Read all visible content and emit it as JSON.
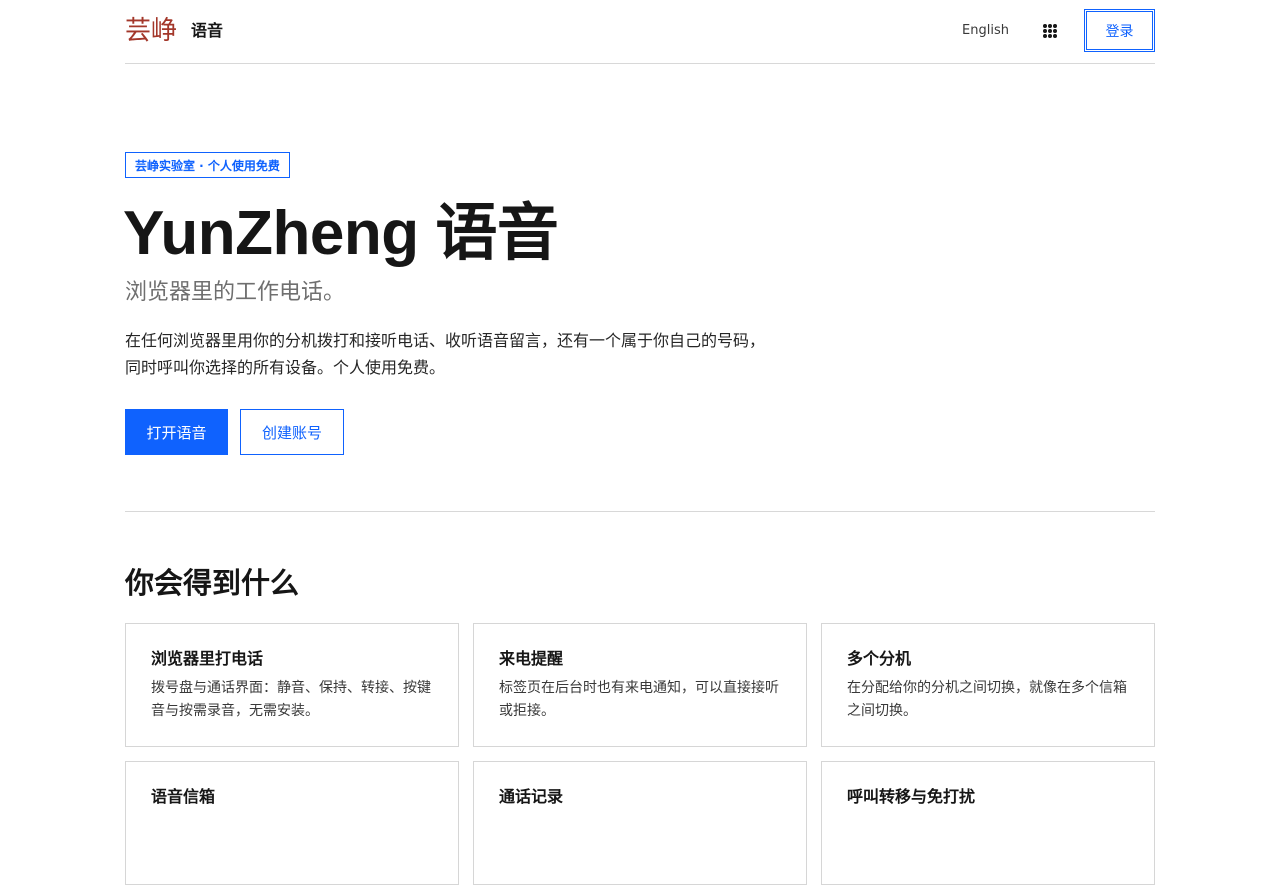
{
  "header": {
    "brand_logo": "芸峥",
    "product_name": "语音",
    "language_link": "English",
    "apps_icon": "grid-dots-icon",
    "login_label": "登录"
  },
  "hero": {
    "tag": "芸峥实验室 · 个人使用免费",
    "title": "YunZheng 语音",
    "subtitle": "浏览器里的工作电话。",
    "description": "在任何浏览器里用你的分机拨打和接听电话、收听语音留言，还有一个属于你自己的号码，同时呼叫你选择的所有设备。个人使用免费。",
    "primary_button": "打开语音",
    "secondary_button": "创建账号"
  },
  "features": {
    "title": "你会得到什么",
    "cards": [
      {
        "title": "浏览器里打电话",
        "body": "拨号盘与通话界面：静音、保持、转接、按键音与按需录音，无需安装。"
      },
      {
        "title": "来电提醒",
        "body": "标签页在后台时也有来电通知，可以直接接听或拒接。"
      },
      {
        "title": "多个分机",
        "body": "在分配给你的分机之间切换，就像在多个信箱之间切换。"
      },
      {
        "title": "语音信箱",
        "body": ""
      },
      {
        "title": "通话记录",
        "body": ""
      },
      {
        "title": "呼叫转移与免打扰",
        "body": ""
      }
    ]
  },
  "colors": {
    "accent": "#0f62fe",
    "brand_logo": "#a3372a",
    "text": "#161616",
    "muted": "#6f6f6f"
  }
}
